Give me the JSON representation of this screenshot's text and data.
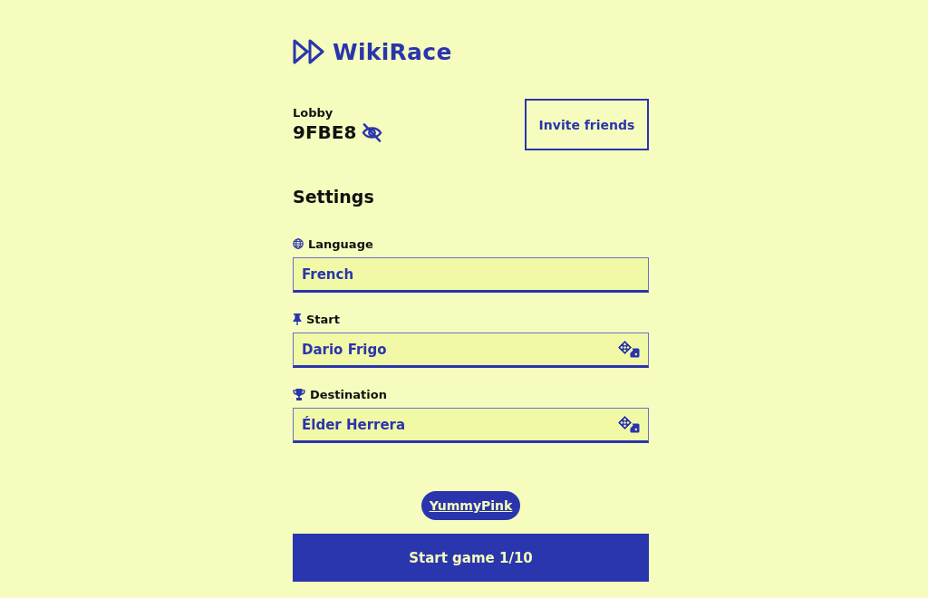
{
  "app": {
    "title": "WikiRace"
  },
  "lobby": {
    "label": "Lobby",
    "code": "9FBE8"
  },
  "invite_button": "Invite friends",
  "settings": {
    "title": "Settings",
    "fields": [
      {
        "kind": "select",
        "label": "Language",
        "value": "French"
      },
      {
        "kind": "random",
        "label": "Start",
        "value": "Dario Frigo"
      },
      {
        "kind": "random",
        "label": "Destination",
        "value": "Élder Herrera"
      }
    ]
  },
  "players": [
    {
      "name": "YummyPink"
    }
  ],
  "start_button": "Start game 1/10"
}
